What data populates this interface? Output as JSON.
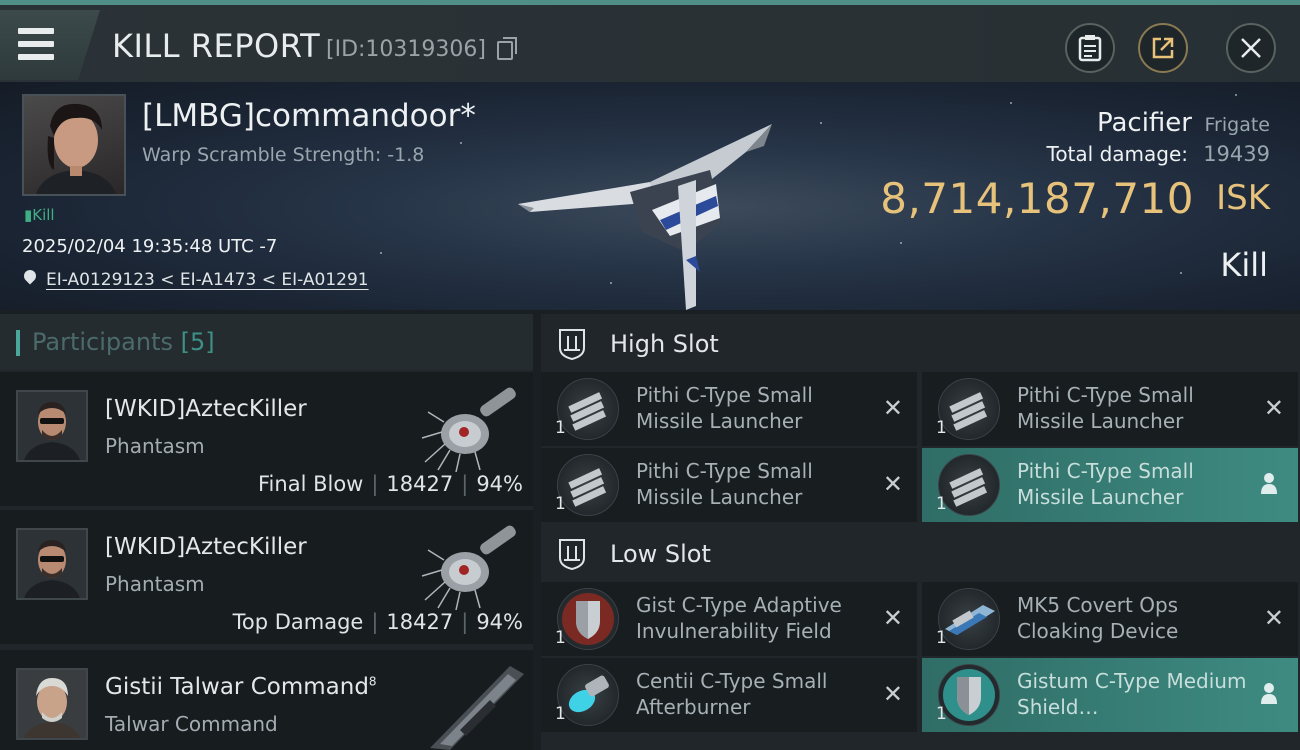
{
  "header": {
    "title": "KILL REPORT",
    "report_id": "[ID:10319306]"
  },
  "victim": {
    "name": "[LMBG]commandoor*",
    "warp_scramble": "Warp Scramble Strength: -1.8",
    "kill_tag": "Kill",
    "timestamp": "2025/02/04 19:35:48 UTC -7",
    "location": "EI-A0129123 < EI-A1473 < EI-A01291"
  },
  "ship": {
    "name": "Pacifier",
    "class": "Frigate",
    "total_damage_label": "Total damage:",
    "total_damage": "19439",
    "isk_value": "8,714,187,710",
    "isk_unit": "ISK",
    "status": "Kill"
  },
  "participants": {
    "label": "Participants",
    "count": "[5]",
    "rows": [
      {
        "name": "[WKID]AztecKiller",
        "ship": "Phantasm",
        "role": "Final Blow",
        "damage": "18427",
        "percent": "94%"
      },
      {
        "name": "[WKID]AztecKiller",
        "ship": "Phantasm",
        "role": "Top Damage",
        "damage": "18427",
        "percent": "94%"
      },
      {
        "name": "Gistii Talwar Command",
        "superscript": "8",
        "ship": "Talwar Command"
      }
    ]
  },
  "slots": {
    "high": {
      "title": "High Slot",
      "modules": [
        {
          "name": "Pithi C-Type Small Missile Launcher",
          "qty": "1",
          "state": "destroyed"
        },
        {
          "name": "Pithi C-Type Small Missile Launcher",
          "qty": "1",
          "state": "destroyed"
        },
        {
          "name": "Pithi C-Type Small Missile Launcher",
          "qty": "1",
          "state": "destroyed"
        },
        {
          "name": "Pithi C-Type Small Missile Launcher",
          "qty": "1",
          "state": "dropped"
        }
      ]
    },
    "low": {
      "title": "Low Slot",
      "modules": [
        {
          "name": "Gist C-Type Adaptive Invulnerability Field",
          "qty": "1",
          "state": "destroyed"
        },
        {
          "name": "MK5 Covert Ops Cloaking Device",
          "qty": "1",
          "state": "destroyed"
        },
        {
          "name": "Centii C-Type Small Afterburner",
          "qty": "1",
          "state": "destroyed"
        },
        {
          "name": "Gistum C-Type Medium Shield…",
          "qty": "1",
          "state": "dropped"
        }
      ]
    }
  },
  "colors": {
    "accent": "#4f8f87",
    "isk": "#e6c27a",
    "dropped": "#3e8b82"
  },
  "icons": {
    "destroyed": "close-icon",
    "dropped": "person-icon"
  }
}
